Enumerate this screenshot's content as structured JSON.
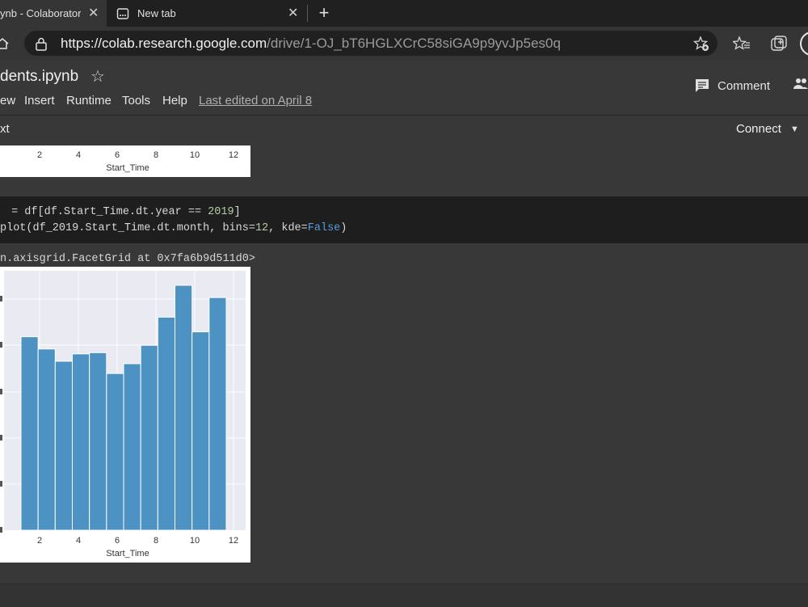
{
  "browser": {
    "tabs": [
      {
        "label": "ynb - Colaborator",
        "active": true
      },
      {
        "label": "New tab",
        "active": false
      }
    ],
    "url_main": "https://colab.research.google.com",
    "url_path": "/drive/1-OJ_bT6HGLXCrC58siGA9p9yvJp5es0q"
  },
  "colab": {
    "title": "dents.ipynb",
    "menu": [
      "ew",
      "Insert",
      "Runtime",
      "Tools",
      "Help"
    ],
    "last_edited": "Last edited on April 8",
    "comment_label": "Comment",
    "toolbar_text": "xt",
    "connect_label": "Connect"
  },
  "cell": {
    "line1_a": " = df[df.Start_Time.dt.year == ",
    "line1_num": "2019",
    "line1_b": "]",
    "line2_a": "plot(df_2019.Start_Time.dt.month, bins=",
    "line2_num": "12",
    "line2_b": ", kde=",
    "line2_kw": "False",
    "line2_c": ")",
    "output": "n.axisgrid.FacetGrid at 0x7fa6b9d511d0>"
  },
  "chart_data": [
    {
      "type": "bar",
      "xlabel": "Start_Time",
      "xticks": [
        "2",
        "4",
        "6",
        "8",
        "10",
        "12"
      ],
      "visible": "bottom axis only (partially scrolled)"
    },
    {
      "type": "bar",
      "xlabel": "Start_Time",
      "xticks": [
        "2",
        "4",
        "6",
        "8",
        "10",
        "12"
      ],
      "bins": 12,
      "x_range": [
        1,
        12
      ],
      "relative_heights": [
        0.79,
        0.74,
        0.69,
        0.72,
        0.725,
        0.64,
        0.68,
        0.755,
        0.87,
        1.0,
        0.81,
        0.95
      ],
      "color": "#4c92c3",
      "background": "#eaeaf2",
      "grid": true
    }
  ]
}
